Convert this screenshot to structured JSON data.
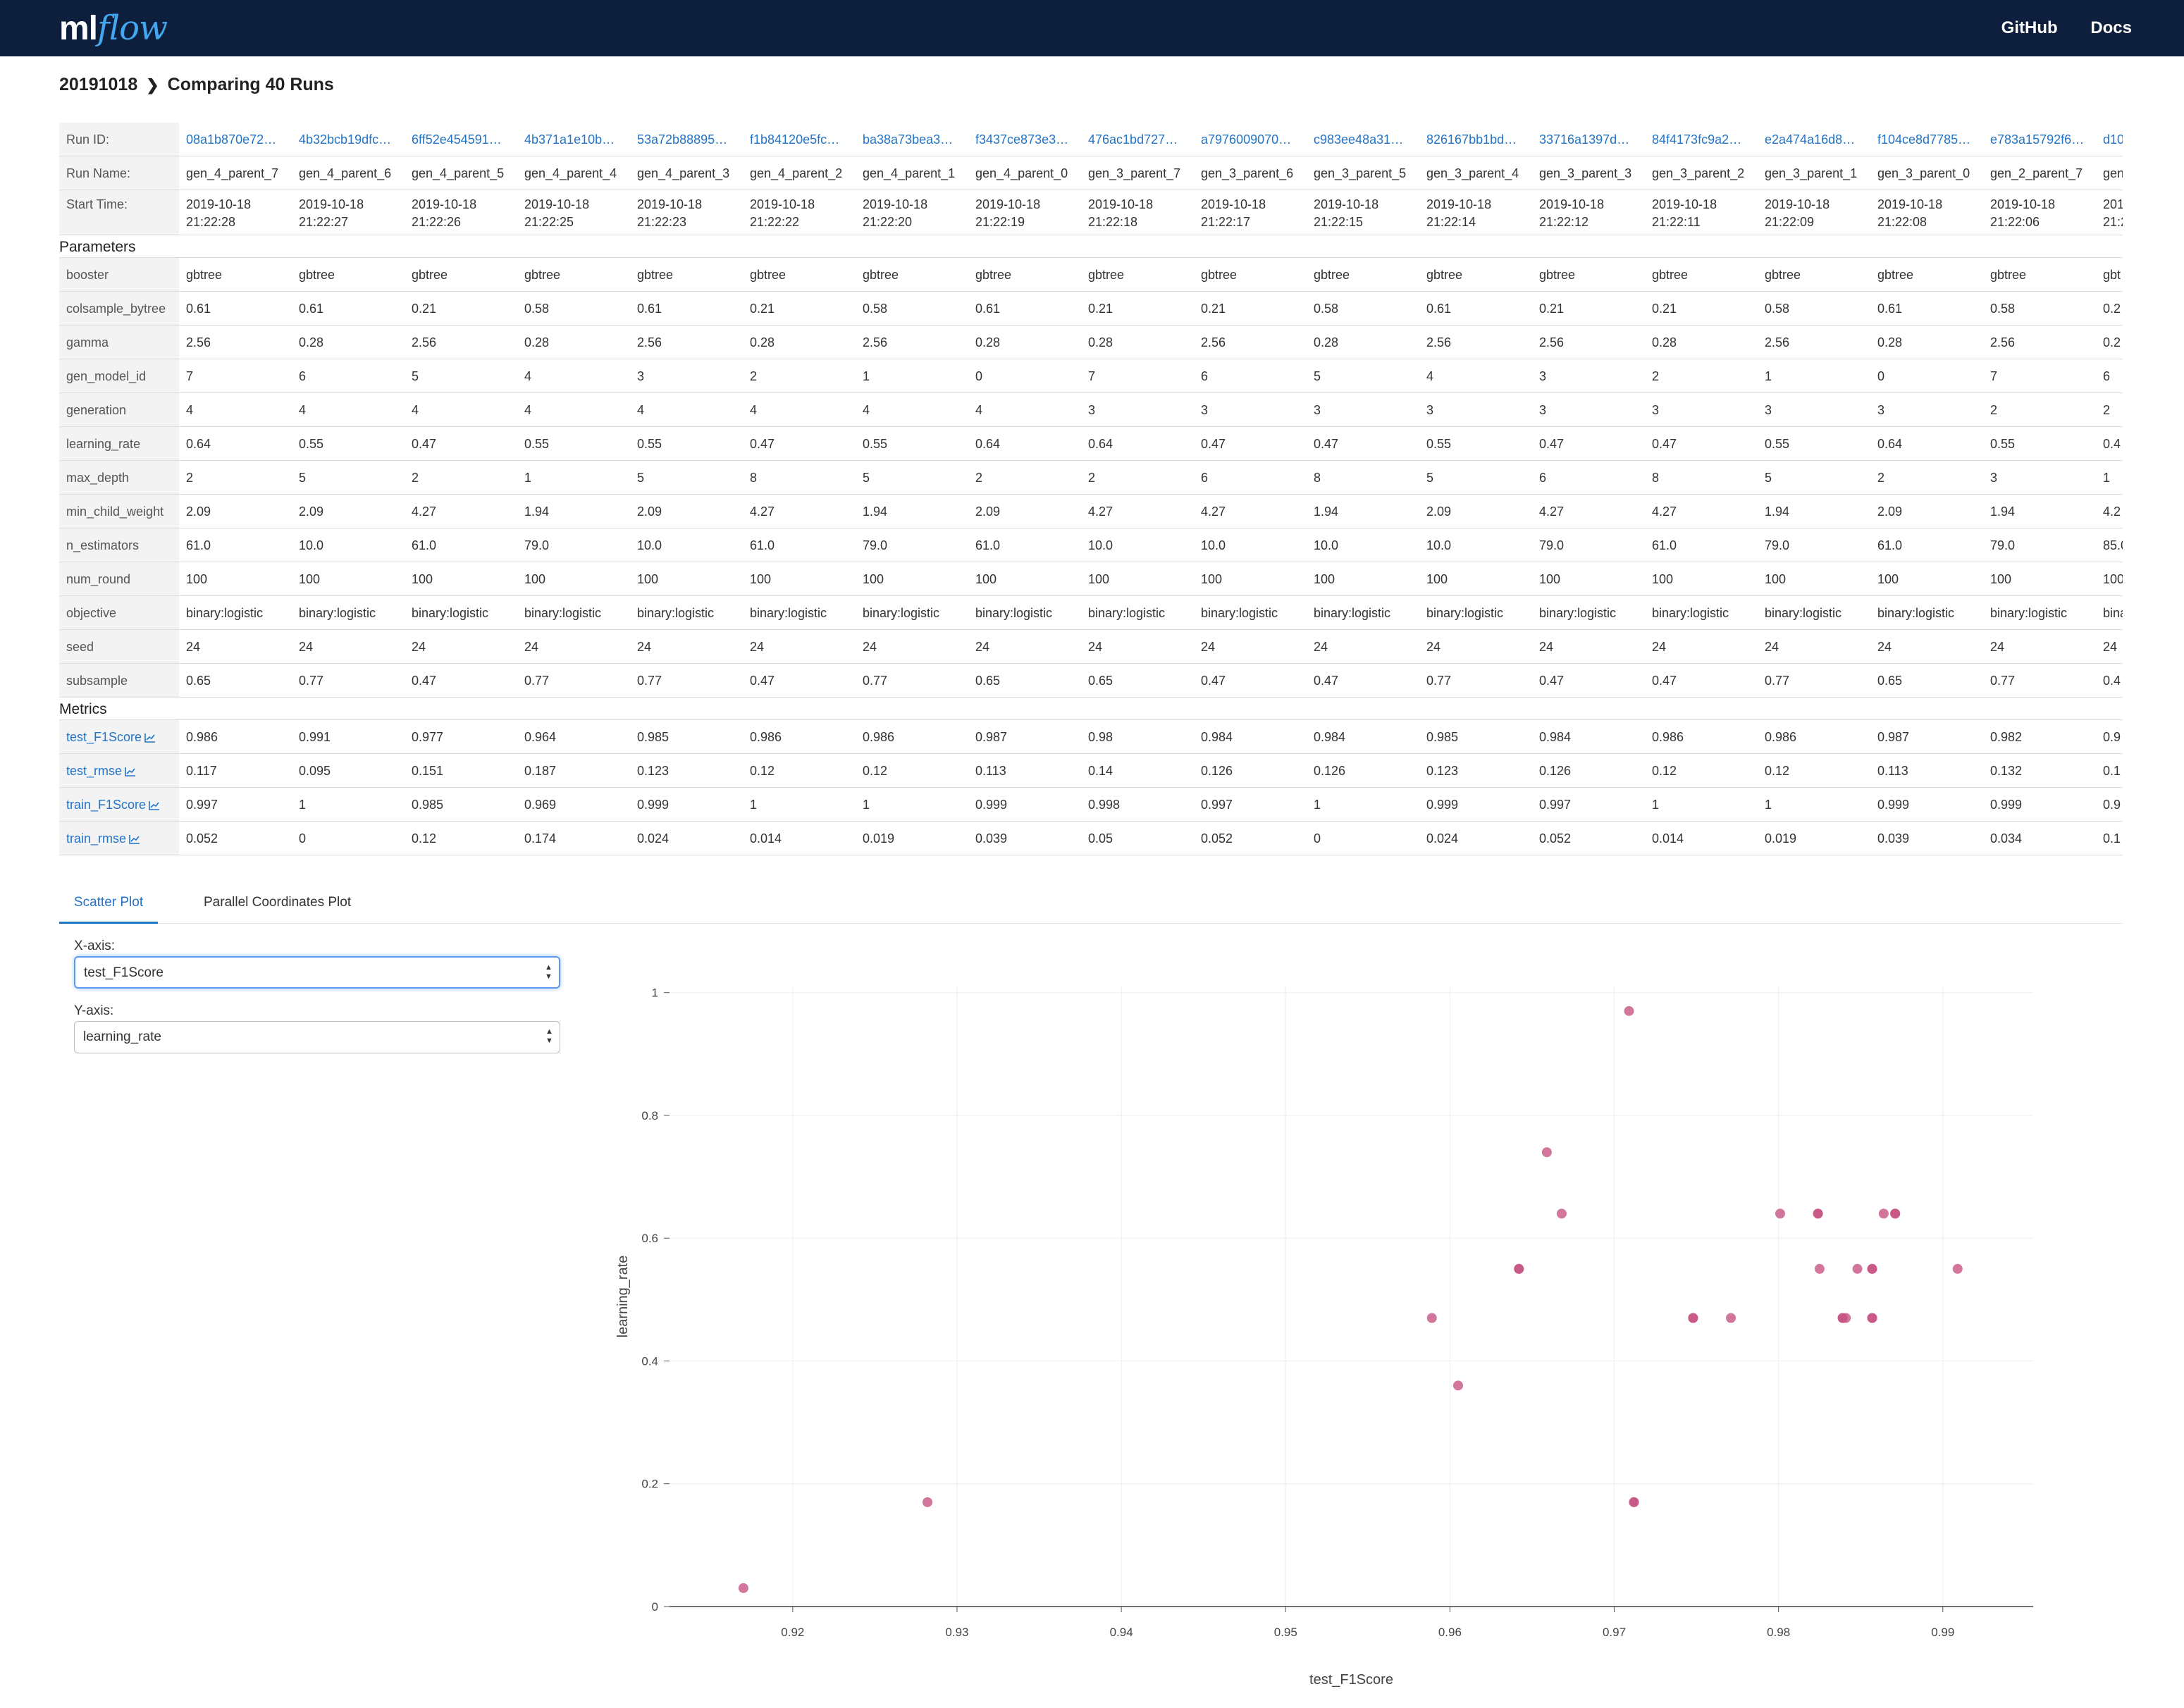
{
  "app": {
    "logo_ml": "ml",
    "logo_flow": "flow"
  },
  "nav": {
    "github": "GitHub",
    "docs": "Docs"
  },
  "breadcrumb": {
    "experiment": "20191018",
    "title": "Comparing 40 Runs"
  },
  "labels": {
    "run_id": "Run ID:",
    "run_name": "Run Name:",
    "start_time": "Start Time:",
    "parameters": "Parameters",
    "metrics": "Metrics"
  },
  "runs": [
    {
      "id": "08a1b870e72…",
      "name": "gen_4_parent_7",
      "date": "2019-10-18",
      "time": "21:22:28"
    },
    {
      "id": "4b32bcb19dfc…",
      "name": "gen_4_parent_6",
      "date": "2019-10-18",
      "time": "21:22:27"
    },
    {
      "id": "6ff52e454591…",
      "name": "gen_4_parent_5",
      "date": "2019-10-18",
      "time": "21:22:26"
    },
    {
      "id": "4b371a1e10b…",
      "name": "gen_4_parent_4",
      "date": "2019-10-18",
      "time": "21:22:25"
    },
    {
      "id": "53a72b88895…",
      "name": "gen_4_parent_3",
      "date": "2019-10-18",
      "time": "21:22:23"
    },
    {
      "id": "f1b84120e5fc…",
      "name": "gen_4_parent_2",
      "date": "2019-10-18",
      "time": "21:22:22"
    },
    {
      "id": "ba38a73bea3…",
      "name": "gen_4_parent_1",
      "date": "2019-10-18",
      "time": "21:22:20"
    },
    {
      "id": "f3437ce873e3…",
      "name": "gen_4_parent_0",
      "date": "2019-10-18",
      "time": "21:22:19"
    },
    {
      "id": "476ac1bd727…",
      "name": "gen_3_parent_7",
      "date": "2019-10-18",
      "time": "21:22:18"
    },
    {
      "id": "a7976009070…",
      "name": "gen_3_parent_6",
      "date": "2019-10-18",
      "time": "21:22:17"
    },
    {
      "id": "c983ee48a31…",
      "name": "gen_3_parent_5",
      "date": "2019-10-18",
      "time": "21:22:15"
    },
    {
      "id": "826167bb1bd…",
      "name": "gen_3_parent_4",
      "date": "2019-10-18",
      "time": "21:22:14"
    },
    {
      "id": "33716a1397d…",
      "name": "gen_3_parent_3",
      "date": "2019-10-18",
      "time": "21:22:12"
    },
    {
      "id": "84f4173fc9a2…",
      "name": "gen_3_parent_2",
      "date": "2019-10-18",
      "time": "21:22:11"
    },
    {
      "id": "e2a474a16d8…",
      "name": "gen_3_parent_1",
      "date": "2019-10-18",
      "time": "21:22:09"
    },
    {
      "id": "f104ce8d7785…",
      "name": "gen_3_parent_0",
      "date": "2019-10-18",
      "time": "21:22:08"
    },
    {
      "id": "e783a15792f6…",
      "name": "gen_2_parent_7",
      "date": "2019-10-18",
      "time": "21:22:06"
    },
    {
      "id": "d10",
      "name": "gen",
      "date": "201",
      "time": "21:2"
    }
  ],
  "params": [
    {
      "name": "booster",
      "values": [
        "gbtree",
        "gbtree",
        "gbtree",
        "gbtree",
        "gbtree",
        "gbtree",
        "gbtree",
        "gbtree",
        "gbtree",
        "gbtree",
        "gbtree",
        "gbtree",
        "gbtree",
        "gbtree",
        "gbtree",
        "gbtree",
        "gbtree",
        "gbt"
      ]
    },
    {
      "name": "colsample_bytree",
      "values": [
        "0.61",
        "0.61",
        "0.21",
        "0.58",
        "0.61",
        "0.21",
        "0.58",
        "0.61",
        "0.21",
        "0.21",
        "0.58",
        "0.61",
        "0.21",
        "0.21",
        "0.58",
        "0.61",
        "0.58",
        "0.2"
      ]
    },
    {
      "name": "gamma",
      "values": [
        "2.56",
        "0.28",
        "2.56",
        "0.28",
        "2.56",
        "0.28",
        "2.56",
        "0.28",
        "0.28",
        "2.56",
        "0.28",
        "2.56",
        "2.56",
        "0.28",
        "2.56",
        "0.28",
        "2.56",
        "0.2"
      ]
    },
    {
      "name": "gen_model_id",
      "values": [
        "7",
        "6",
        "5",
        "4",
        "3",
        "2",
        "1",
        "0",
        "7",
        "6",
        "5",
        "4",
        "3",
        "2",
        "1",
        "0",
        "7",
        "6"
      ]
    },
    {
      "name": "generation",
      "values": [
        "4",
        "4",
        "4",
        "4",
        "4",
        "4",
        "4",
        "4",
        "3",
        "3",
        "3",
        "3",
        "3",
        "3",
        "3",
        "3",
        "2",
        "2"
      ]
    },
    {
      "name": "learning_rate",
      "values": [
        "0.64",
        "0.55",
        "0.47",
        "0.55",
        "0.55",
        "0.47",
        "0.55",
        "0.64",
        "0.64",
        "0.47",
        "0.47",
        "0.55",
        "0.47",
        "0.47",
        "0.55",
        "0.64",
        "0.55",
        "0.4"
      ]
    },
    {
      "name": "max_depth",
      "values": [
        "2",
        "5",
        "2",
        "1",
        "5",
        "8",
        "5",
        "2",
        "2",
        "6",
        "8",
        "5",
        "6",
        "8",
        "5",
        "2",
        "3",
        "1"
      ]
    },
    {
      "name": "min_child_weight",
      "values": [
        "2.09",
        "2.09",
        "4.27",
        "1.94",
        "2.09",
        "4.27",
        "1.94",
        "2.09",
        "4.27",
        "4.27",
        "1.94",
        "2.09",
        "4.27",
        "4.27",
        "1.94",
        "2.09",
        "1.94",
        "4.2"
      ]
    },
    {
      "name": "n_estimators",
      "values": [
        "61.0",
        "10.0",
        "61.0",
        "79.0",
        "10.0",
        "61.0",
        "79.0",
        "61.0",
        "10.0",
        "10.0",
        "10.0",
        "10.0",
        "79.0",
        "61.0",
        "79.0",
        "61.0",
        "79.0",
        "85.0"
      ]
    },
    {
      "name": "num_round",
      "values": [
        "100",
        "100",
        "100",
        "100",
        "100",
        "100",
        "100",
        "100",
        "100",
        "100",
        "100",
        "100",
        "100",
        "100",
        "100",
        "100",
        "100",
        "100"
      ]
    },
    {
      "name": "objective",
      "values": [
        "binary:logistic",
        "binary:logistic",
        "binary:logistic",
        "binary:logistic",
        "binary:logistic",
        "binary:logistic",
        "binary:logistic",
        "binary:logistic",
        "binary:logistic",
        "binary:logistic",
        "binary:logistic",
        "binary:logistic",
        "binary:logistic",
        "binary:logistic",
        "binary:logistic",
        "binary:logistic",
        "binary:logistic",
        "bina"
      ]
    },
    {
      "name": "seed",
      "values": [
        "24",
        "24",
        "24",
        "24",
        "24",
        "24",
        "24",
        "24",
        "24",
        "24",
        "24",
        "24",
        "24",
        "24",
        "24",
        "24",
        "24",
        "24"
      ]
    },
    {
      "name": "subsample",
      "values": [
        "0.65",
        "0.77",
        "0.47",
        "0.77",
        "0.77",
        "0.47",
        "0.77",
        "0.65",
        "0.65",
        "0.47",
        "0.47",
        "0.77",
        "0.47",
        "0.47",
        "0.77",
        "0.65",
        "0.77",
        "0.4"
      ]
    }
  ],
  "metrics": [
    {
      "name": "test_F1Score",
      "values": [
        "0.986",
        "0.991",
        "0.977",
        "0.964",
        "0.985",
        "0.986",
        "0.986",
        "0.987",
        "0.98",
        "0.984",
        "0.984",
        "0.985",
        "0.984",
        "0.986",
        "0.986",
        "0.987",
        "0.982",
        "0.9"
      ]
    },
    {
      "name": "test_rmse",
      "values": [
        "0.117",
        "0.095",
        "0.151",
        "0.187",
        "0.123",
        "0.12",
        "0.12",
        "0.113",
        "0.14",
        "0.126",
        "0.126",
        "0.123",
        "0.126",
        "0.12",
        "0.12",
        "0.113",
        "0.132",
        "0.1"
      ]
    },
    {
      "name": "train_F1Score",
      "values": [
        "0.997",
        "1",
        "0.985",
        "0.969",
        "0.999",
        "1",
        "1",
        "0.999",
        "0.998",
        "0.997",
        "1",
        "0.999",
        "0.997",
        "1",
        "1",
        "0.999",
        "0.999",
        "0.9"
      ]
    },
    {
      "name": "train_rmse",
      "values": [
        "0.052",
        "0",
        "0.12",
        "0.174",
        "0.024",
        "0.014",
        "0.019",
        "0.039",
        "0.05",
        "0.052",
        "0",
        "0.024",
        "0.052",
        "0.014",
        "0.019",
        "0.039",
        "0.034",
        "0.1"
      ]
    }
  ],
  "tabs": {
    "scatter": "Scatter Plot",
    "parallel": "Parallel Coordinates Plot"
  },
  "controls": {
    "x_label": "X-axis:",
    "x_value": "test_F1Score",
    "y_label": "Y-axis:",
    "y_value": "learning_rate"
  },
  "colors": {
    "header_bg": "#0e1f3e",
    "link": "#2374c6",
    "point": "#c75482"
  },
  "chart_data": {
    "type": "scatter",
    "xlabel": "test_F1Score",
    "ylabel": "learning_rate",
    "xlim": [
      0.9125,
      0.9955
    ],
    "ylim": [
      0,
      1.01
    ],
    "xticks": [
      "0.92",
      "0.93",
      "0.94",
      "0.95",
      "0.96",
      "0.97",
      "0.98",
      "0.99"
    ],
    "yticks": [
      "0",
      "0.2",
      "0.4",
      "0.6",
      "0.8",
      "1"
    ],
    "grid": true,
    "points": [
      {
        "x": 0.917,
        "y": 0.03
      },
      {
        "x": 0.9282,
        "y": 0.17
      },
      {
        "x": 0.9589,
        "y": 0.47
      },
      {
        "x": 0.9605,
        "y": 0.36
      },
      {
        "x": 0.9642,
        "y": 0.55
      },
      {
        "x": 0.9642,
        "y": 0.55
      },
      {
        "x": 0.9659,
        "y": 0.74
      },
      {
        "x": 0.9668,
        "y": 0.64
      },
      {
        "x": 0.9709,
        "y": 0.97
      },
      {
        "x": 0.9712,
        "y": 0.17
      },
      {
        "x": 0.9712,
        "y": 0.17
      },
      {
        "x": 0.9748,
        "y": 0.47
      },
      {
        "x": 0.9748,
        "y": 0.47
      },
      {
        "x": 0.9771,
        "y": 0.47
      },
      {
        "x": 0.9801,
        "y": 0.64
      },
      {
        "x": 0.9824,
        "y": 0.64
      },
      {
        "x": 0.9824,
        "y": 0.64
      },
      {
        "x": 0.9825,
        "y": 0.55
      },
      {
        "x": 0.9839,
        "y": 0.47
      },
      {
        "x": 0.9839,
        "y": 0.47
      },
      {
        "x": 0.9841,
        "y": 0.47
      },
      {
        "x": 0.9848,
        "y": 0.55
      },
      {
        "x": 0.9857,
        "y": 0.55
      },
      {
        "x": 0.9857,
        "y": 0.55
      },
      {
        "x": 0.9857,
        "y": 0.47
      },
      {
        "x": 0.9857,
        "y": 0.47
      },
      {
        "x": 0.9864,
        "y": 0.64
      },
      {
        "x": 0.9871,
        "y": 0.64
      },
      {
        "x": 0.9871,
        "y": 0.64
      },
      {
        "x": 0.9909,
        "y": 0.55
      }
    ]
  }
}
